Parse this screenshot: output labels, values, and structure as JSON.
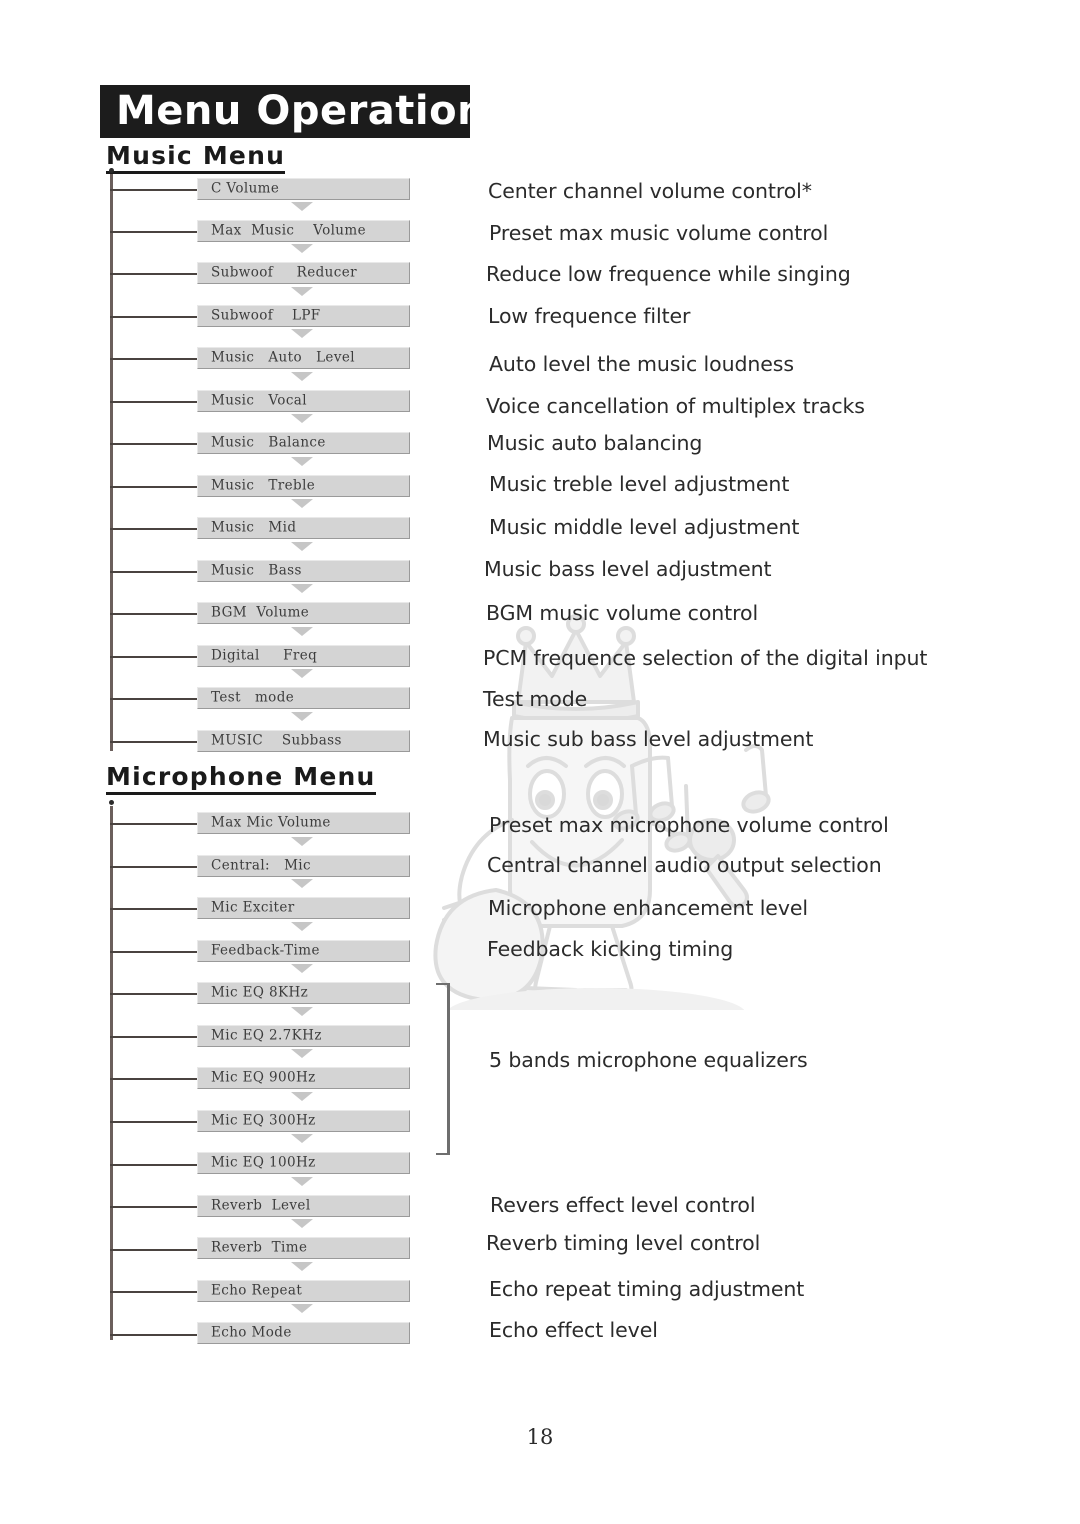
{
  "header": {
    "title": "Menu Operation"
  },
  "sections": [
    {
      "id": "music",
      "heading": "Music Menu",
      "items": [
        {
          "label": "C Volume",
          "desc": "Center channel volume control*"
        },
        {
          "label": "Max  Music    Volume",
          "desc": "Preset max music volume control"
        },
        {
          "label": "Subwoof     Reducer",
          "desc": "Reduce low frequence while singing"
        },
        {
          "label": "Subwoof    LPF",
          "desc": "Low frequence filter"
        },
        {
          "label": "Music   Auto   Level",
          "desc": "Auto level the music loudness"
        },
        {
          "label": "Music   Vocal",
          "desc": "Voice cancellation of multiplex tracks"
        },
        {
          "label": "Music   Balance",
          "desc": "Music auto balancing"
        },
        {
          "label": "Music   Treble",
          "desc": "Music treble level adjustment"
        },
        {
          "label": "Music   Mid",
          "desc": "Music middle level adjustment"
        },
        {
          "label": "Music   Bass",
          "desc": "Music bass level adjustment"
        },
        {
          "label": "BGM  Volume",
          "desc": "BGM music volume control"
        },
        {
          "label": "Digital     Freq",
          "desc": "PCM frequence selection of the digital input"
        },
        {
          "label": "Test   mode",
          "desc": "Test mode"
        },
        {
          "label": "MUSIC    Subbass",
          "desc": "Music sub bass level adjustment"
        }
      ]
    },
    {
      "id": "microphone",
      "heading": "Microphone Menu",
      "items": [
        {
          "label": "Max Mic Volume",
          "desc": "Preset max microphone volume control"
        },
        {
          "label": "Central:   Mic",
          "desc": "Central channel audio output selection"
        },
        {
          "label": "Mic Exciter",
          "desc": "Microphone enhancement level"
        },
        {
          "label": "Feedback-Time",
          "desc": "Feedback kicking timing"
        },
        {
          "label": "Mic EQ 8KHz",
          "desc": ""
        },
        {
          "label": "Mic EQ 2.7KHz",
          "desc": ""
        },
        {
          "label": "Mic EQ 900Hz",
          "desc": ""
        },
        {
          "label": "Mic EQ 300Hz",
          "desc": ""
        },
        {
          "label": "Mic EQ 100Hz",
          "desc": ""
        },
        {
          "label": "Reverb  Level",
          "desc": "Revers effect level control"
        },
        {
          "label": "Reverb  Time",
          "desc": "Reverb timing level control"
        },
        {
          "label": "Echo Repeat",
          "desc": "Echo repeat timing adjustment"
        },
        {
          "label": "Echo Mode",
          "desc": "Echo effect level"
        }
      ],
      "group_annotation": "5 bands microphone equalizers"
    }
  ],
  "footer": {
    "page_number": "18"
  },
  "colors": {
    "title_bar_bg": "#1c1c1c",
    "title_text": "#ffffff",
    "box_fill": "#d4d4d4",
    "box_text": "#3d3d3d",
    "arrow": "#c6c6c6",
    "spine": "#6b5f5c",
    "body_text": "#2b2b2b"
  }
}
